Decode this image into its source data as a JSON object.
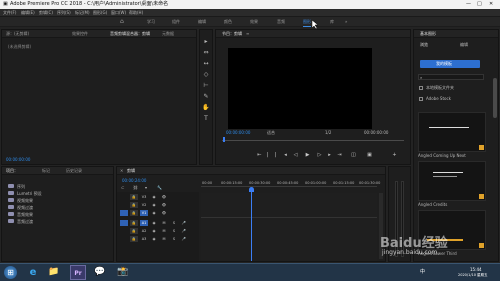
{
  "window": {
    "title": "Adobe Premiere Pro CC 2018 - C:\\用户\\Administrator\\桌面\\未命名",
    "controls": [
      "—",
      "□",
      "✕"
    ]
  },
  "menu": [
    "文件(F)",
    "编辑(E)",
    "剪辑(C)",
    "序列(S)",
    "标记(M)",
    "图形(G)",
    "窗口(W)",
    "帮助(H)"
  ],
  "workspaces": {
    "home": "⌂",
    "tabs": [
      "学习",
      "组件",
      "编辑",
      "颜色",
      "效果",
      "音频",
      "图形",
      "库"
    ],
    "more": "»",
    "active_index": 6
  },
  "source_panel": {
    "tabs": [
      "源：(无剪辑)",
      "效果控件",
      "音频剪辑混合器：剪辑",
      "元数据"
    ],
    "empty_text": "(未选择剪辑)",
    "timecode": "00:00:00:00"
  },
  "program_monitor": {
    "title": "节目：剪辑",
    "menu": "≡",
    "timecode_left": "00:00:00:00",
    "fit": "适合",
    "quality": "1/2",
    "timecode_right": "00:00:00:00",
    "controls": [
      "⇤",
      "|",
      "|",
      "◂",
      "◁",
      "▶",
      "▷",
      "▸",
      "⇥",
      "◫",
      "▣",
      "+"
    ]
  },
  "tools": [
    "▸",
    "⇔",
    "↔",
    "◇",
    "⊢",
    "✎",
    "✋",
    "T"
  ],
  "project_panel": {
    "tabs": [
      "项目：",
      "标记",
      "历史记录"
    ],
    "items": [
      {
        "label": "序列"
      },
      {
        "label": "Lumetri 预设"
      },
      {
        "label": "视频效果"
      },
      {
        "label": "视频过渡"
      },
      {
        "label": "音频效果"
      },
      {
        "label": "音频过渡"
      }
    ]
  },
  "timeline": {
    "title": "剪辑",
    "timecode": "00:00:24:00",
    "ruler_labels": [
      "00:00",
      "00:00:15:00",
      "00:00:30:00",
      "00:00:45:00",
      "00:01:00:00",
      "00:01:15:00",
      "00:01:30:00"
    ],
    "video_tracks": [
      "V3",
      "V2",
      "V1"
    ],
    "audio_tracks": [
      "A1",
      "A2",
      "A3"
    ],
    "track_buttons": [
      "🔒",
      "◉",
      "👁",
      "M",
      "S",
      "🎤"
    ]
  },
  "graphics_panel": {
    "title": "基本图形",
    "tabs": [
      "浏览",
      "编辑"
    ],
    "my_templates": "我的模板",
    "adobe_stock_checkbox": "本地模板文件夹",
    "local_checkbox": "Adobe Stock",
    "templates": [
      {
        "label": "Angled Coming Up Next"
      },
      {
        "label": "Angled Credits"
      },
      {
        "label": "Angled Lower Third"
      }
    ]
  },
  "taskbar": {
    "start": "⊞",
    "apps": [
      "e",
      "📁",
      "Pr",
      "💬",
      "📸"
    ],
    "time": "15:44",
    "date": "2020/1/10 星期五",
    "ime": "中"
  },
  "watermark": {
    "brand": "Baidu经验",
    "url": "jingyan.baidu.com"
  },
  "colors": {
    "accent": "#2d8ceb",
    "taskbar": "#223447",
    "panel": "#1e1e1e",
    "playhead": "#3b7ef5"
  }
}
